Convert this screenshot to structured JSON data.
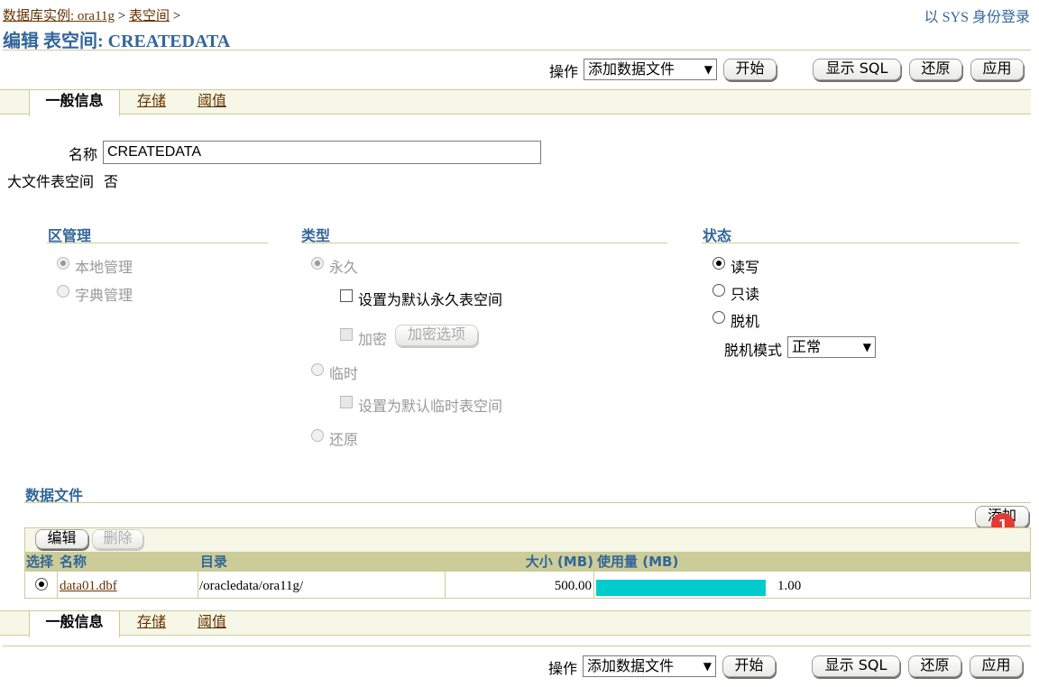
{
  "breadcrumb": {
    "instance": "数据库实例: ora11g",
    "sep1": ">",
    "tablespaces": "表空间",
    "sep2": ">"
  },
  "login_info": "以 SYS 身份登录",
  "page_title": "编辑 表空间: CREATEDATA",
  "toolbar": {
    "action_label": "操作",
    "action_value": "添加数据文件",
    "go": "开始",
    "show_sql": "显示 SQL",
    "revert": "还原",
    "apply": "应用"
  },
  "tabs": [
    "一般信息",
    "存储",
    "阈值"
  ],
  "general": {
    "name_label": "名称",
    "name_value": "CREATEDATA",
    "bigfile_label": "大文件表空间",
    "bigfile_value": "否"
  },
  "extent": {
    "header": "区管理",
    "local": "本地管理",
    "dictionary": "字典管理"
  },
  "type": {
    "header": "类型",
    "permanent": "永久",
    "default_permanent": "设置为默认永久表空间",
    "encrypt": "加密",
    "encrypt_options": "加密选项",
    "temporary": "临时",
    "default_temporary": "设置为默认临时表空间",
    "undo": "还原"
  },
  "status": {
    "header": "状态",
    "read_write": "读写",
    "read_only": "只读",
    "offline": "脱机",
    "offline_mode_label": "脱机模式",
    "offline_mode_value": "正常"
  },
  "datafiles": {
    "header": "数据文件",
    "add": "添加",
    "edit": "编辑",
    "delete": "删除",
    "badge": "1",
    "columns": {
      "select": "选择",
      "name": "名称",
      "directory": "目录",
      "size": "大小 (MB)",
      "usage": "使用量 (MB)"
    },
    "rows": [
      {
        "name": "data01.dbf",
        "directory": "/oracledata/ora11g/",
        "size": "500.00",
        "usage": "1.00",
        "usage_fraction": 0.998,
        "usage_color": "#00cccc"
      }
    ]
  }
}
